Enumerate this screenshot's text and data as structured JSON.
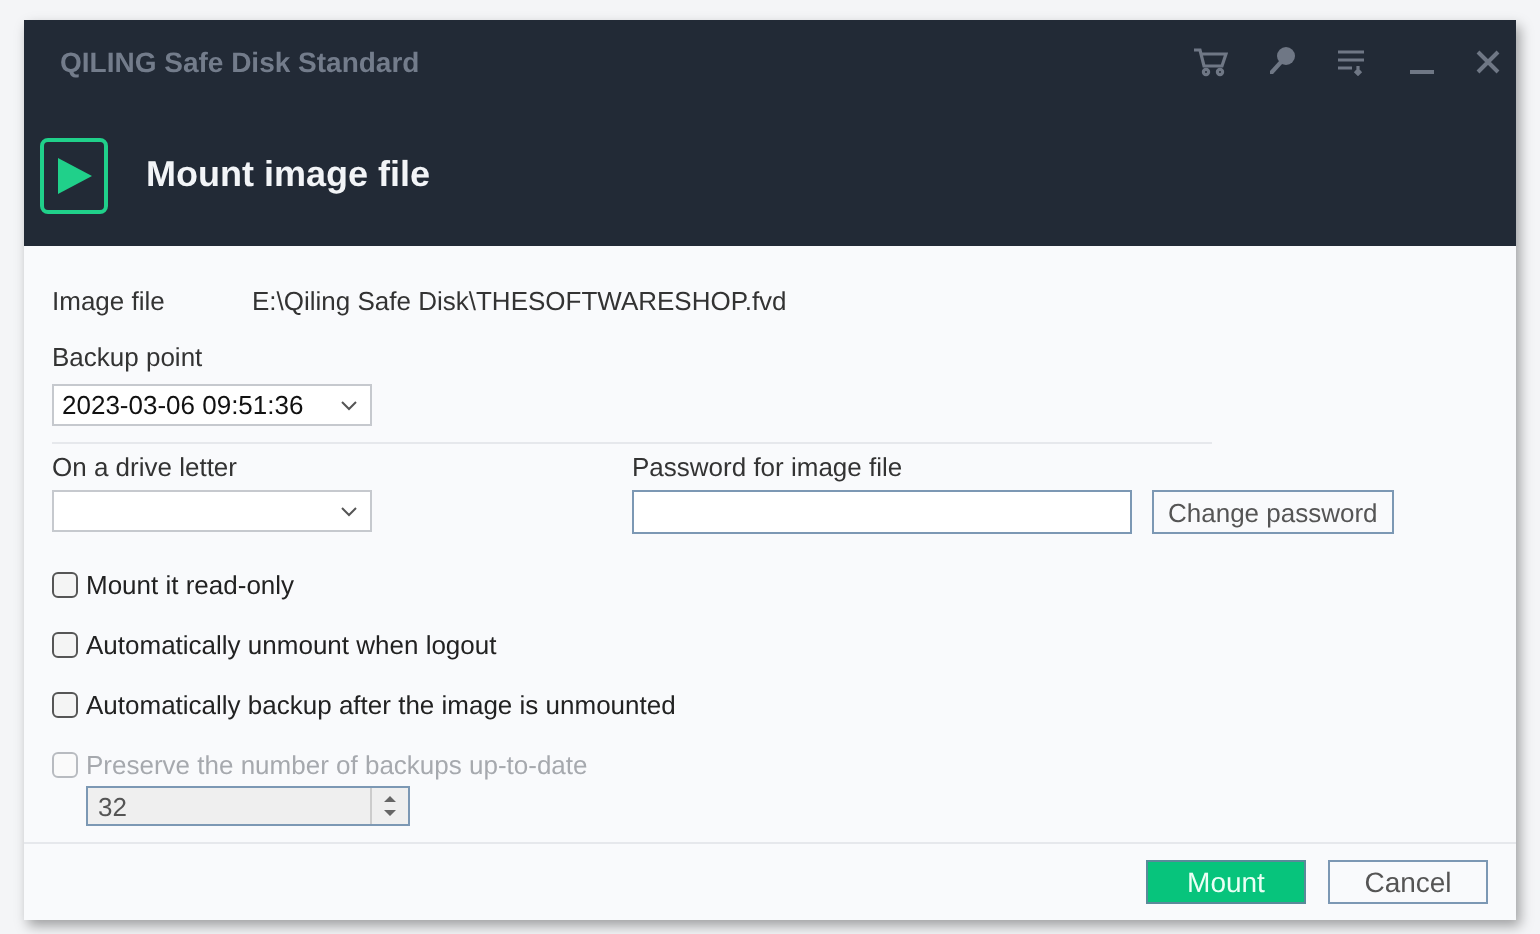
{
  "window": {
    "title": "QILING Safe Disk Standard"
  },
  "header": {
    "title": "Mount image file"
  },
  "image_file": {
    "label": "Image file",
    "value": "E:\\Qiling Safe Disk\\THESOFTWARESHOP.fvd"
  },
  "backup_point": {
    "label": "Backup point",
    "value": "2023-03-06 09:51:36"
  },
  "drive_letter": {
    "label": "On a drive letter"
  },
  "password": {
    "label": "Password for image file",
    "button": "Change password"
  },
  "options": [
    {
      "label": "Mount it read-only",
      "checked": false,
      "disabled": false
    },
    {
      "label": "Automatically unmount when logout",
      "checked": false,
      "disabled": false
    },
    {
      "label": "Automatically backup after the image is unmounted",
      "checked": false,
      "disabled": false
    },
    {
      "label": "Preserve the number of backups up-to-date",
      "checked": false,
      "disabled": true
    }
  ],
  "backup_count": {
    "value": "32",
    "disabled": true
  },
  "buttons": [
    {
      "label": "Mount",
      "kind": "primary"
    },
    {
      "label": "Cancel",
      "kind": "secondary"
    }
  ]
}
